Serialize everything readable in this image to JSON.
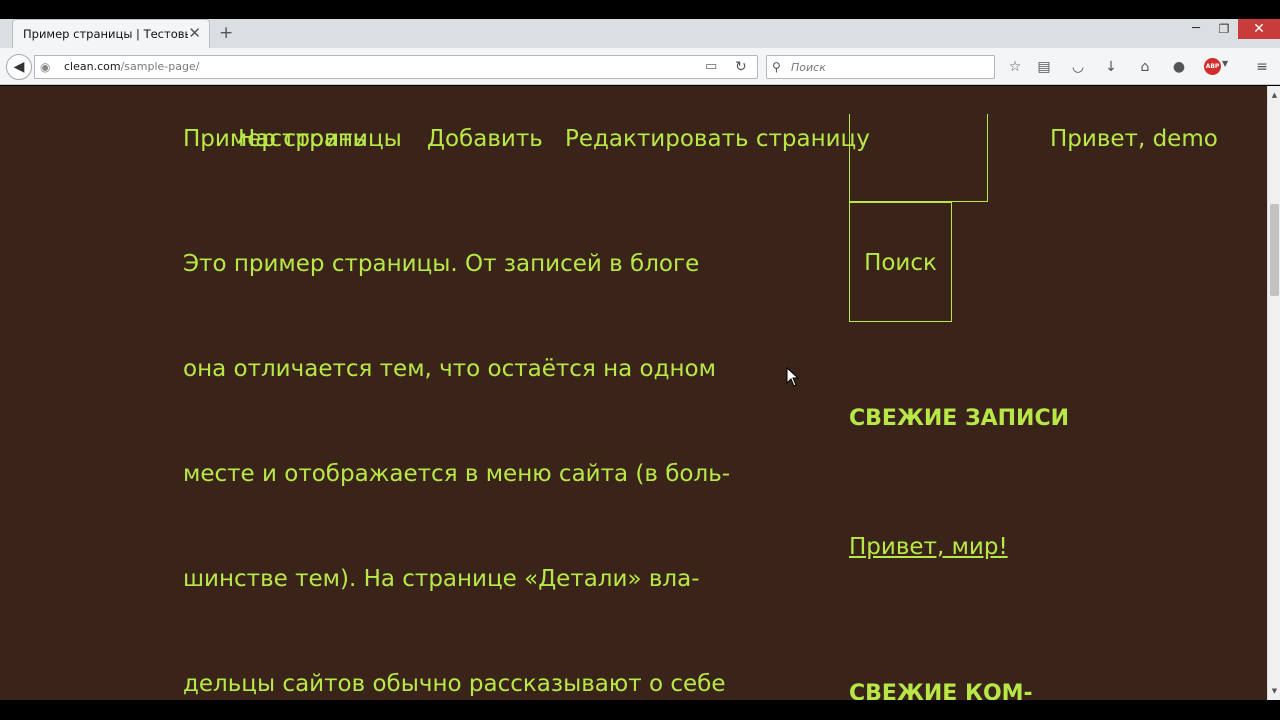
{
  "browser": {
    "tab": {
      "title": "Пример страницы | Тестовы..."
    },
    "url": {
      "host": "clean.com",
      "path": "/sample-page/"
    },
    "search_placeholder": "Поиск",
    "colors": {
      "close_button": "#c83c3c",
      "abp": "#d12d2d"
    }
  },
  "page": {
    "colors": {
      "background": "#3a2419",
      "text": "#b7e848"
    },
    "title": "Пример страницы",
    "admin_bar": {
      "customize": "Настроить",
      "add": "Добавить",
      "edit": "Редактировать страницу",
      "greeting": "Привет, demo"
    },
    "content": {
      "lines": [
        "Это пример страницы. От записей в блоге",
        "она отличается тем, что остаётся на одном",
        "месте и отображается в меню сайта (в боль-",
        "шинстве тем). На странице «Детали» вла-",
        "дельцы сайтов обычно рассказывают о себе"
      ]
    },
    "sidebar": {
      "search_button": "Поиск",
      "recent_posts_title": "СВЕЖИЕ ЗАПИСИ",
      "recent_posts": [
        "Привет, мир!"
      ],
      "recent_comments_title": "СВЕЖИЕ КОМ-"
    }
  }
}
